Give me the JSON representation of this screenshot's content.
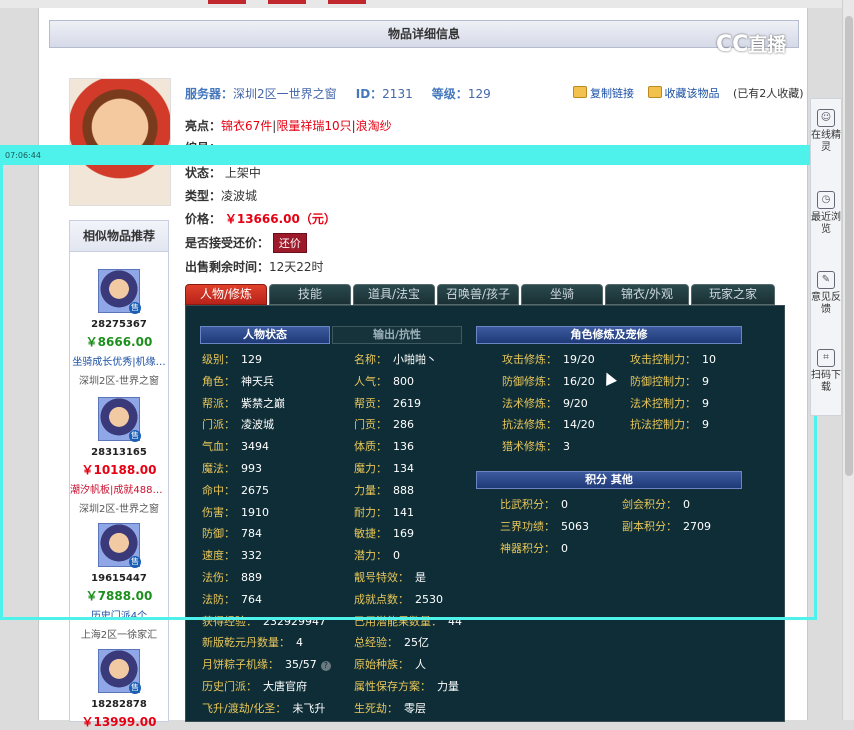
{
  "window": {
    "title": "物品详细信息"
  },
  "brand": {
    "logo_text": "CC",
    "logo_sub": "直播"
  },
  "overlay": {
    "timestamp": "07:06:44"
  },
  "header": {
    "server_label": "服务器：",
    "server_value": "深圳2区一世界之窗",
    "id_label": "ID：",
    "id_value": "2131",
    "level_label": "等级：",
    "level_value": "129",
    "copy_link": "复制链接",
    "favorite": "收藏该物品",
    "favorite_count": "(已有2人收藏)"
  },
  "item": {
    "highlight_label": "亮点：",
    "highlights": [
      "锦衣67件",
      "限量祥瑞10只",
      "浪淘纱"
    ],
    "number_label": "编号：",
    "status_label": "状态：",
    "status_value": "上架中",
    "type_label": "类型：",
    "type_value": "凌波城",
    "price_label": "价格：",
    "price_value": "￥13666.00（元）",
    "offer_label": "是否接受还价：",
    "offer_button": "还价",
    "remain_label": "出售剩余时间：",
    "remain_value": "12天22时"
  },
  "sidebar": {
    "title": "相似物品推荐",
    "items": [
      {
        "id": "28275367",
        "price": "￥8666.00",
        "tags": "坐骑成长优秀|机缘…",
        "server": "深圳2区-世界之窗"
      },
      {
        "id": "28313165",
        "price": "￥10188.00",
        "tags": "潮汐帆板|成就4888|…",
        "server": "深圳2区-世界之窗"
      },
      {
        "id": "19615447",
        "price": "￥7888.00",
        "tags": "历史门派4个",
        "server": "上海2区一徐家汇"
      },
      {
        "id": "18282878",
        "price": "￥13999.00",
        "tags": "",
        "server": ""
      }
    ],
    "sell_badge": "售"
  },
  "tabs": [
    "人物/修炼",
    "技能",
    "道具/法宝",
    "召唤兽/孩子",
    "坐骑",
    "锦衣/外观",
    "玩家之家"
  ],
  "panel": {
    "char_status_header": "人物状态",
    "output_header": "输出/抗性",
    "cultivation_header": "角色修炼及宠修",
    "points_header": "积分  其他",
    "left_col": [
      {
        "k": "级别：",
        "v": "129"
      },
      {
        "k": "角色：",
        "v": "神天兵"
      },
      {
        "k": "帮派：",
        "v": "紫禁之巅"
      },
      {
        "k": "门派：",
        "v": "凌波城"
      },
      {
        "k": "气血：",
        "v": "3494"
      },
      {
        "k": "魔法：",
        "v": "993"
      },
      {
        "k": "命中：",
        "v": "2675"
      },
      {
        "k": "伤害：",
        "v": "1910"
      },
      {
        "k": "防御：",
        "v": "784"
      },
      {
        "k": "速度：",
        "v": "332"
      },
      {
        "k": "法伤：",
        "v": "889"
      },
      {
        "k": "法防：",
        "v": "764"
      },
      {
        "k": "获得经验：",
        "v": "232929947"
      },
      {
        "k": "新版乾元丹数量：",
        "v": "4"
      },
      {
        "k": "月饼粽子机缘：",
        "v": "35/57"
      },
      {
        "k": "历史门派：",
        "v": "大唐官府"
      },
      {
        "k": "飞升/渡劫/化圣：",
        "v": "未飞升"
      }
    ],
    "mid_col": [
      {
        "k": "名称：",
        "v": "小啪啪丶"
      },
      {
        "k": "人气：",
        "v": "800"
      },
      {
        "k": "帮贡：",
        "v": "2619"
      },
      {
        "k": "门贡：",
        "v": "286"
      },
      {
        "k": "体质：",
        "v": "136"
      },
      {
        "k": "魔力：",
        "v": "134"
      },
      {
        "k": "力量：",
        "v": "888"
      },
      {
        "k": "耐力：",
        "v": "141"
      },
      {
        "k": "敏捷：",
        "v": "169"
      },
      {
        "k": "潜力：",
        "v": "0"
      },
      {
        "k": "靓号特效：",
        "v": "是"
      },
      {
        "k": "成就点数：",
        "v": "2530"
      },
      {
        "k": "已用潜能果数量：",
        "v": "44"
      },
      {
        "k": "总经验：",
        "v": "25亿"
      },
      {
        "k": "原始种族：",
        "v": "人"
      },
      {
        "k": "属性保存方案：",
        "v": "力量"
      },
      {
        "k": "生死劫：",
        "v": "零层"
      }
    ],
    "cult_left": [
      {
        "k": "攻击修炼：",
        "v": "19/20"
      },
      {
        "k": "防御修炼：",
        "v": "16/20"
      },
      {
        "k": "法术修炼：",
        "v": "9/20"
      },
      {
        "k": "抗法修炼：",
        "v": "14/20"
      },
      {
        "k": "猎术修炼：",
        "v": "3"
      }
    ],
    "cult_right": [
      {
        "k": "攻击控制力：",
        "v": "10"
      },
      {
        "k": "防御控制力：",
        "v": "9"
      },
      {
        "k": "法术控制力：",
        "v": "9"
      },
      {
        "k": "抗法控制力：",
        "v": "9"
      }
    ],
    "points_left": [
      {
        "k": "比武积分：",
        "v": "0"
      },
      {
        "k": "三界功绩：",
        "v": "5063"
      },
      {
        "k": "神器积分：",
        "v": "0"
      }
    ],
    "points_right": [
      {
        "k": "剑会积分：",
        "v": "0"
      },
      {
        "k": "副本积分：",
        "v": "2709"
      }
    ]
  },
  "rightpanel": {
    "items": [
      "在线精灵",
      "最近浏览",
      "意见反馈",
      "扫码下载"
    ]
  },
  "colors": {
    "panel_bg": "#0e2d36",
    "label_gold": "#e8c659",
    "price_red": "#e60012",
    "accent_cyan": "#4ff2ea",
    "active_tab": "#d2321f"
  }
}
